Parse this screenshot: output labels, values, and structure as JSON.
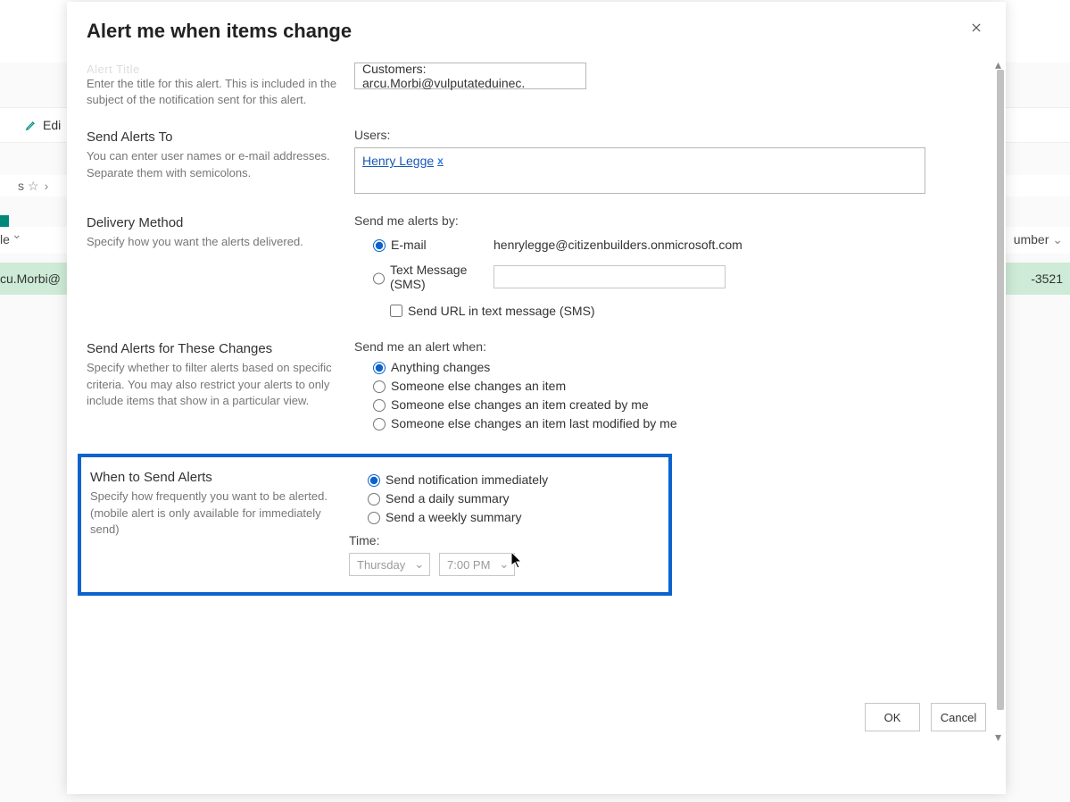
{
  "background": {
    "edit_label": "Edi",
    "breadcrumb_tail": "s",
    "column_le_label": "le",
    "column_number_label": "umber",
    "row_email": "cu.Morbi@",
    "row_number": "-3521"
  },
  "modal": {
    "title": "Alert me when items change",
    "sections": {
      "alert_title": {
        "faded_heading": "Alert Title",
        "desc": "Enter the title for this alert. This is included in the subject of the notification sent for this alert.",
        "input_value": "Customers: arcu.Morbi@vulputateduinec."
      },
      "send_to": {
        "title": "Send Alerts To",
        "desc": "You can enter user names or e-mail addresses. Separate them with semicolons.",
        "users_label": "Users:",
        "user_chip": "Henry Legge",
        "remove_x": "x"
      },
      "delivery": {
        "title": "Delivery Method",
        "desc": "Specify how you want the alerts delivered.",
        "group_label": "Send me alerts by:",
        "opt_email": "E-mail",
        "email_value": "henrylegge@citizenbuilders.onmicrosoft.com",
        "opt_sms": "Text Message (SMS)",
        "sms_value": "",
        "url_checkbox": "Send URL in text message (SMS)"
      },
      "changes": {
        "title": "Send Alerts for These Changes",
        "desc": "Specify whether to filter alerts based on specific criteria. You may also restrict your alerts to only include items that show in a particular view.",
        "group_label": "Send me an alert when:",
        "opts": [
          "Anything changes",
          "Someone else changes an item",
          "Someone else changes an item created by me",
          "Someone else changes an item last modified by me"
        ]
      },
      "when": {
        "title": "When to Send Alerts",
        "desc": "Specify how frequently you want to be alerted. (mobile alert is only available for immediately send)",
        "opts": [
          "Send notification immediately",
          "Send a daily summary",
          "Send a weekly summary"
        ],
        "time_label": "Time:",
        "day": "Thursday",
        "hour": "7:00 PM"
      }
    },
    "footer": {
      "ok": "OK",
      "cancel": "Cancel"
    }
  }
}
